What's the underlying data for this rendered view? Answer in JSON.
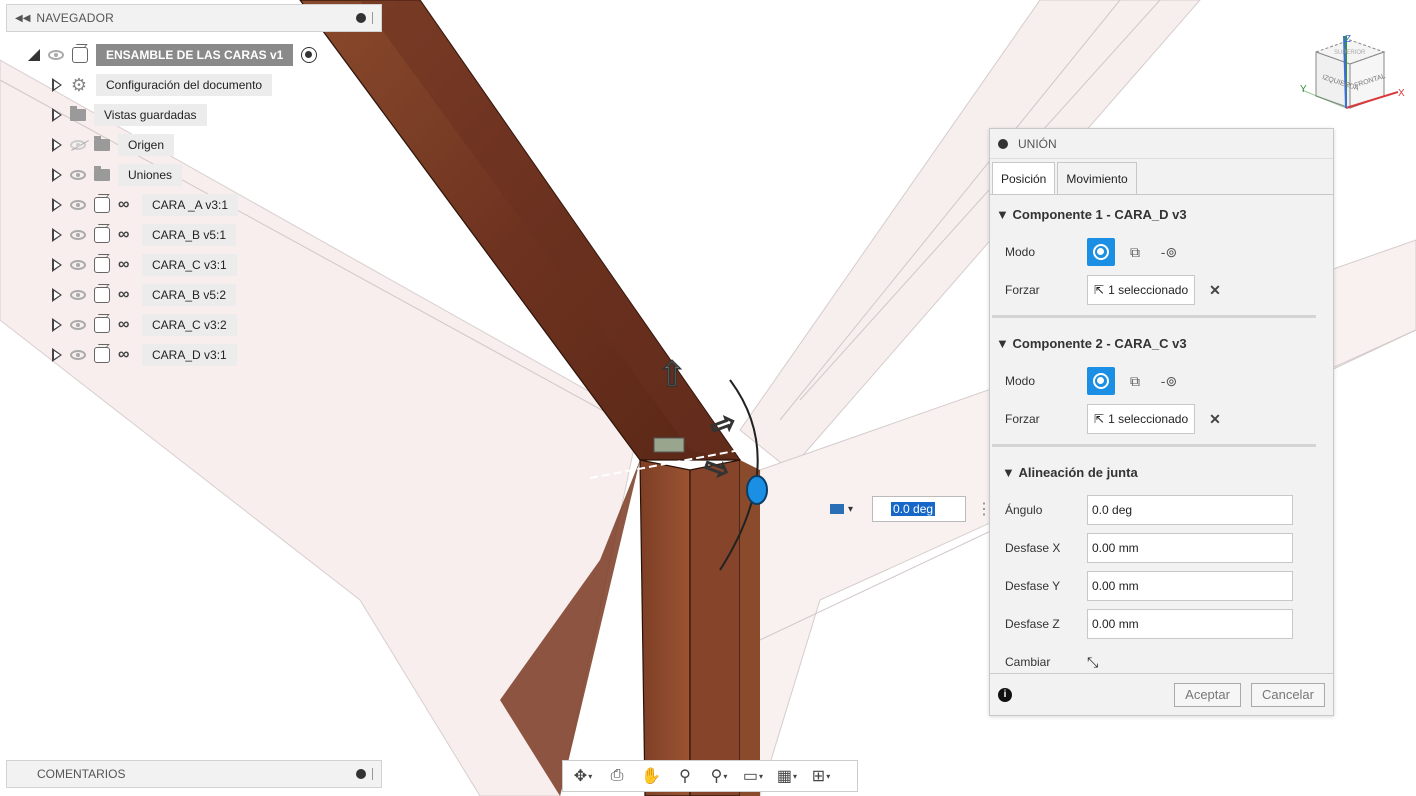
{
  "browser": {
    "title": "NAVEGADOR",
    "root": {
      "label": "ENSAMBLE DE LAS CARAS v1"
    },
    "items": [
      {
        "label": "Configuración del documento",
        "icon": "gear-icon"
      },
      {
        "label": "Vistas guardadas",
        "icon": "folder-icon"
      },
      {
        "label": "Origen",
        "icon": "folder-icon"
      },
      {
        "label": "Uniones",
        "icon": "folder-icon"
      },
      {
        "label": "CARA _A v3:1",
        "icon": "component-icon"
      },
      {
        "label": "CARA_B v5:1",
        "icon": "component-icon"
      },
      {
        "label": "CARA_C v3:1",
        "icon": "component-icon"
      },
      {
        "label": "CARA_B v5:2",
        "icon": "component-icon"
      },
      {
        "label": "CARA_C v3:2",
        "icon": "component-icon"
      },
      {
        "label": "CARA_D v3:1",
        "icon": "component-icon"
      }
    ]
  },
  "comments": {
    "title": "COMENTARIOS"
  },
  "viewcube": {
    "top": "SUPERIOR",
    "left": "IZQUIERDA",
    "front": "FRONTAL",
    "axis_z": "Z",
    "axis_x": "X",
    "axis_y": "Y"
  },
  "angle_input": {
    "value": "0.0 deg"
  },
  "joint_panel": {
    "title": "UNIÓN",
    "tabs": [
      "Posición",
      "Movimiento"
    ],
    "component1": {
      "title": "Componente 1 - CARA_D v3",
      "mode_label": "Modo",
      "snap_label": "Forzar",
      "snap_value": "1 seleccionado"
    },
    "component2": {
      "title": "Componente 2 - CARA_C v3",
      "mode_label": "Modo",
      "snap_label": "Forzar",
      "snap_value": "1 seleccionado"
    },
    "alignment": {
      "title": "Alineación de junta",
      "angle_label": "Ángulo",
      "angle_value": "0.0 deg",
      "offset_x_label": "Desfase X",
      "offset_x_value": "0.00 mm",
      "offset_y_label": "Desfase Y",
      "offset_y_value": "0.00 mm",
      "offset_z_label": "Desfase Z",
      "offset_z_value": "0.00 mm",
      "flip_label": "Cambiar"
    },
    "ok_label": "Aceptar",
    "cancel_label": "Cancelar"
  },
  "colors": {
    "wood": "#7a3a22",
    "accent": "#1a8fe3",
    "selection": "#1767c9"
  }
}
